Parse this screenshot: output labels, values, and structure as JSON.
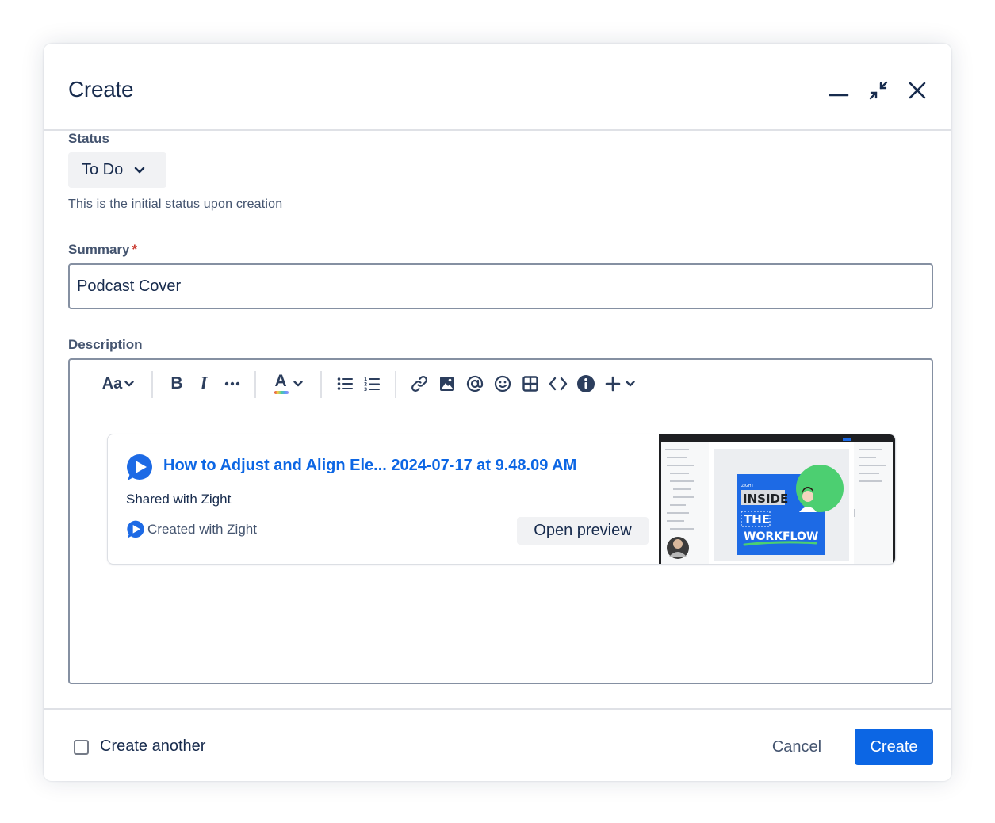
{
  "dialog": {
    "title": "Create",
    "minimize_icon": "minimize-icon",
    "collapse_icon": "collapse-arrows-icon",
    "close_icon": "close-icon"
  },
  "status": {
    "label": "Status",
    "value": "To Do",
    "helper": "This is the initial status upon creation"
  },
  "summary": {
    "label": "Summary",
    "required_mark": "*",
    "value": "Podcast Cover"
  },
  "description": {
    "label": "Description",
    "toolbar": {
      "text_style": "Aa",
      "bold": "B",
      "italic": "I",
      "text_color": "A",
      "icons": [
        "chevron-down-icon",
        "more-icon",
        "bullet-list-icon",
        "numbered-list-icon",
        "link-icon",
        "image-icon",
        "mention-icon",
        "emoji-icon",
        "table-icon",
        "code-icon",
        "info-icon",
        "plus-icon"
      ]
    },
    "card": {
      "title": "How to Adjust and Align Ele... 2024-07-17 at 9.48.09 AM",
      "shared": "Shared with Zight",
      "created": "Created with Zight",
      "preview_button": "Open preview",
      "thumbnail": {
        "line1": "INSIDE",
        "line2": "THE",
        "line3": "WORKFLOW",
        "tag": "ZIGHT"
      }
    }
  },
  "footer": {
    "create_another": "Create another",
    "create_another_checked": false,
    "cancel": "Cancel",
    "create": "Create"
  },
  "colors": {
    "primary": "#0c66e4",
    "text": "#172b4d",
    "subtle_text": "#44546f",
    "required": "#c9372c",
    "thumb_blue": "#1d6ae5",
    "thumb_green": "#4ccf71"
  }
}
